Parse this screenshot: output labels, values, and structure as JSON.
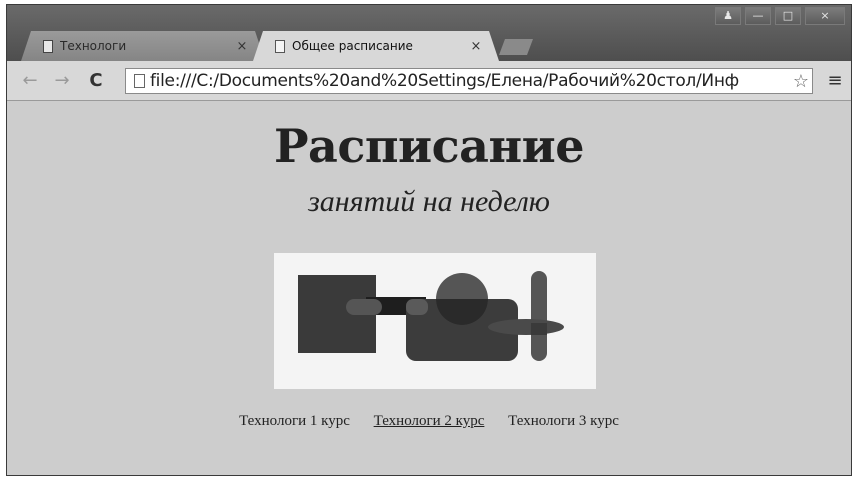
{
  "tabs": [
    {
      "title": "Технологи",
      "active": false,
      "close": "×"
    },
    {
      "title": "Общее расписание",
      "active": true,
      "close": "×"
    }
  ],
  "window_controls": {
    "user": "♟",
    "minimize": "—",
    "maximize": "□",
    "close": "×"
  },
  "toolbar": {
    "back": "←",
    "forward": "→",
    "reload": "C",
    "url": "file:///C:/Documents%20and%20Settings/Елена/Рабочий%20стол/Инф",
    "star": "☆",
    "menu": "≡"
  },
  "page": {
    "heading": "Расписание",
    "subheading": "занятий на неделю",
    "links": [
      "Технологи 1 курс",
      "Технологи 2 курс",
      "Технологи 3 курс"
    ]
  },
  "colors": {
    "content_bg": "#cdcdcd",
    "image_bg": "#f4f4f4",
    "shape_dark": "#2e2e2e",
    "shape_mid": "#555555"
  }
}
